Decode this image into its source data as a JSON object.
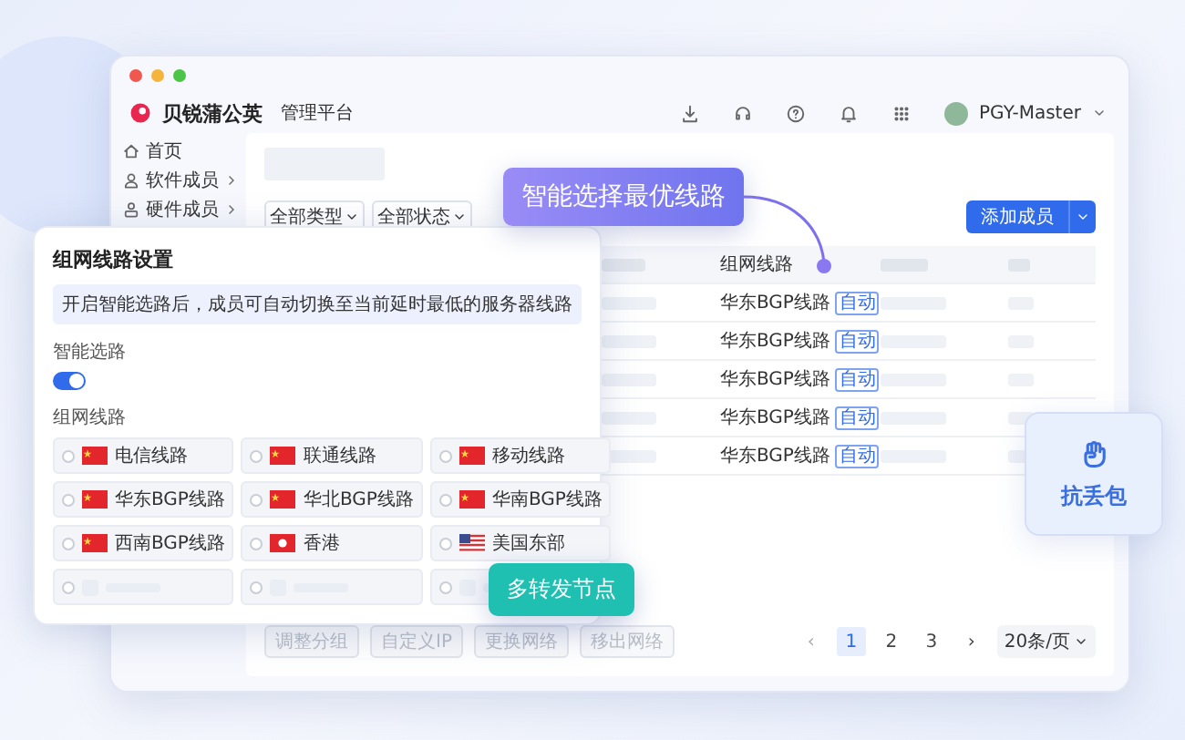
{
  "app": {
    "brand": "贝锐蒲公英",
    "product": "管理平台",
    "user": "PGY-Master"
  },
  "sidebar": {
    "items": [
      {
        "label": "首页",
        "expandable": false
      },
      {
        "label": "软件成员",
        "expandable": true
      },
      {
        "label": "硬件成员",
        "expandable": true
      }
    ]
  },
  "filters": [
    {
      "label": "全部类型"
    },
    {
      "label": "全部状态"
    }
  ],
  "add_button": {
    "label": "添加成员"
  },
  "table": {
    "route_column": "组网线路",
    "rows": [
      {
        "route": "华东BGP线路",
        "tag": "自动"
      },
      {
        "route": "华东BGP线路",
        "tag": "自动"
      },
      {
        "route": "华东BGP线路",
        "tag": "自动"
      },
      {
        "route": "华东BGP线路",
        "tag": "自动"
      },
      {
        "route": "华东BGP线路",
        "tag": "自动"
      }
    ]
  },
  "bulk_actions": [
    {
      "label": "调整分组",
      "disabled": true
    },
    {
      "label": "自定义IP",
      "disabled": true
    },
    {
      "label": "更换网络",
      "disabled": true
    },
    {
      "label": "移出网络",
      "disabled": true
    }
  ],
  "pagination": {
    "prev": "‹",
    "pages": [
      {
        "label": "1",
        "selected": true
      },
      {
        "label": "2",
        "selected": false
      },
      {
        "label": "3",
        "selected": false
      }
    ],
    "next": "›",
    "page_size": "20条/页"
  },
  "route_settings": {
    "title": "组网线路设置",
    "notice": "开启智能选路后，成员可自动切换至当前延时最低的服务器线路",
    "smart_label": "智能选路",
    "smart_on": true,
    "routes_label": "组网线路",
    "routes": [
      {
        "label": "电信线路",
        "kind": "china",
        "selected": false
      },
      {
        "label": "联通线路",
        "kind": "china",
        "selected": false
      },
      {
        "label": "移动线路",
        "kind": "china",
        "selected": false
      },
      {
        "label": "华东BGP线路",
        "kind": "china",
        "selected": false
      },
      {
        "label": "华北BGP线路",
        "kind": "china",
        "selected": false
      },
      {
        "label": "华南BGP线路",
        "kind": "china",
        "selected": false
      },
      {
        "label": "西南BGP线路",
        "kind": "china",
        "selected": false
      },
      {
        "label": "香港",
        "kind": "hongkong",
        "selected": false
      },
      {
        "label": "美国东部",
        "kind": "usa",
        "selected": false
      }
    ]
  },
  "callouts": [
    {
      "kind": "purple",
      "text": "智能选择最优线路"
    },
    {
      "kind": "teal",
      "text": "多转发节点"
    }
  ],
  "feature_card": {
    "label": "抗丢包"
  }
}
